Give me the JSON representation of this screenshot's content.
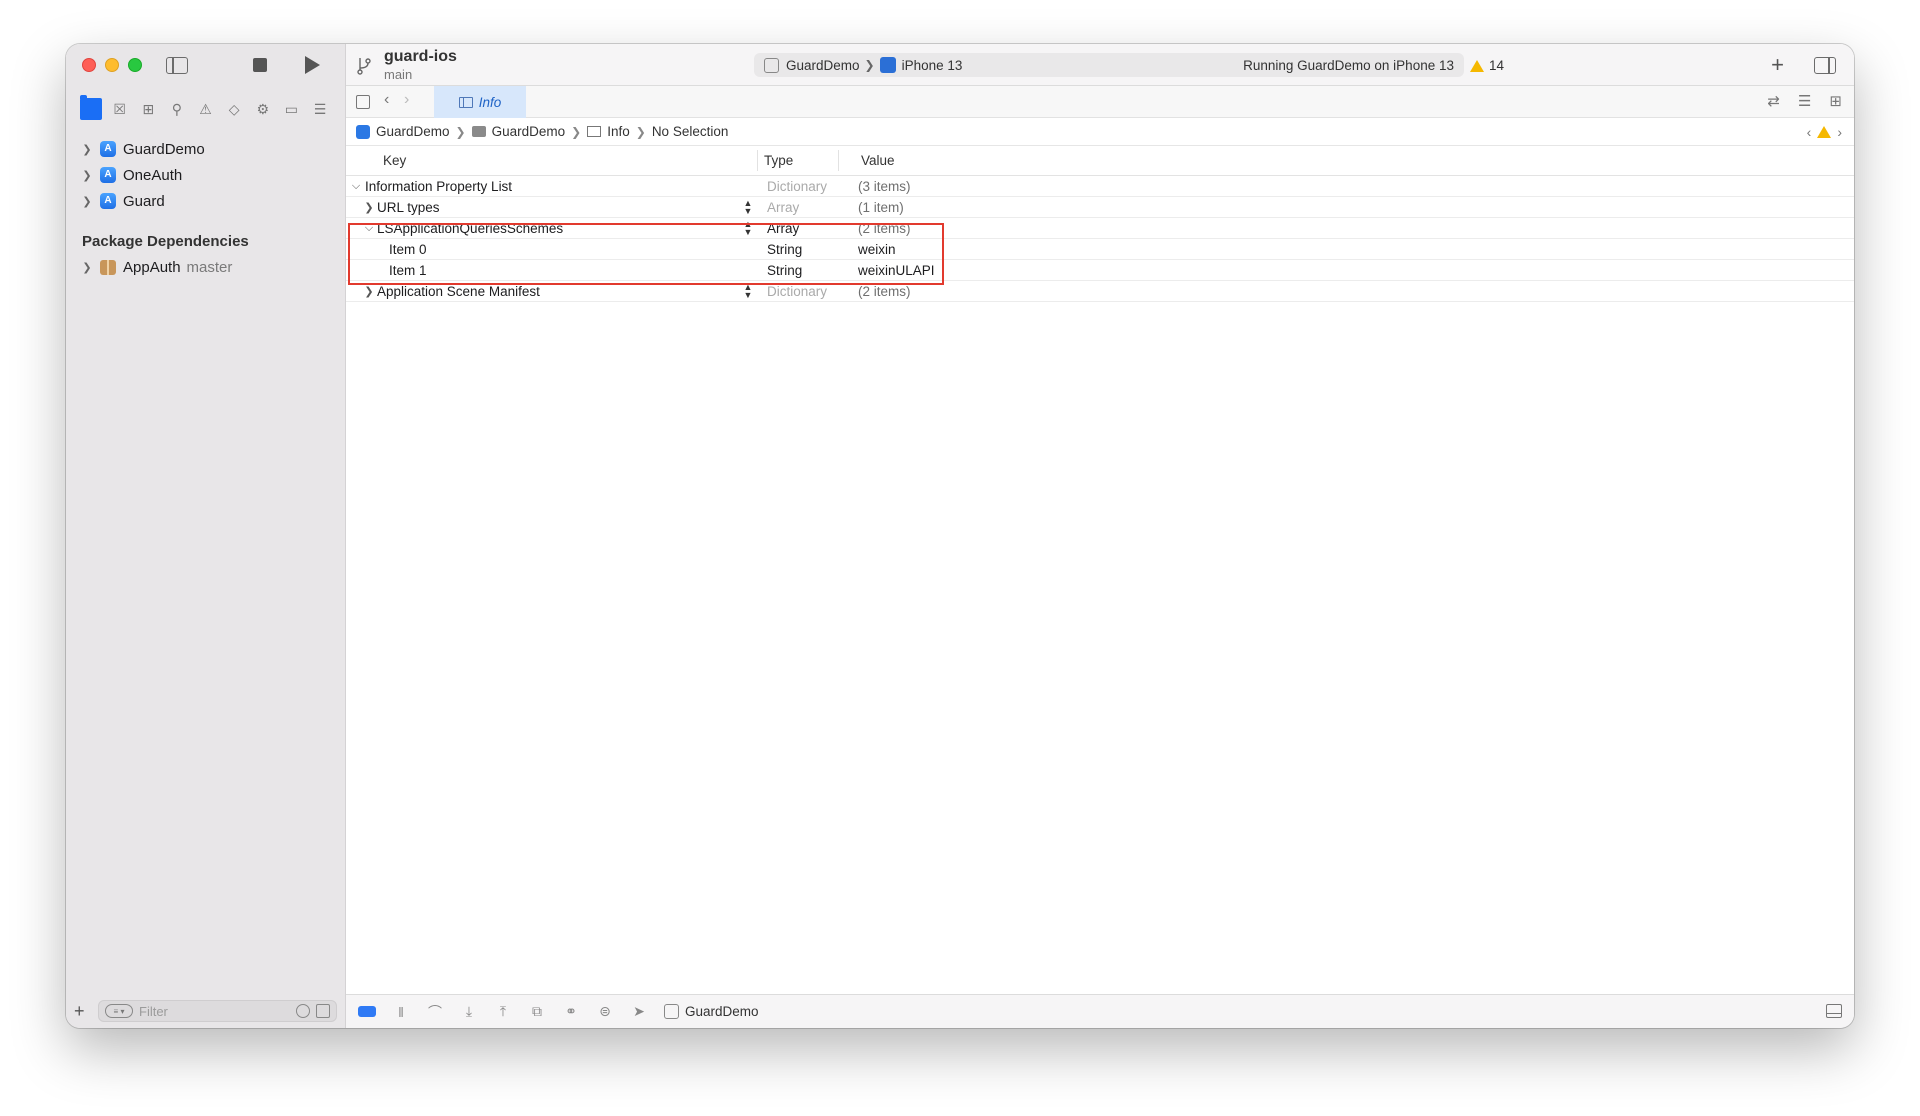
{
  "sidebar": {
    "items": [
      {
        "label": "GuardDemo"
      },
      {
        "label": "OneAuth"
      },
      {
        "label": "Guard"
      }
    ],
    "section_title": "Package Dependencies",
    "packages": [
      {
        "label": "AppAuth",
        "branch": "master"
      }
    ],
    "filter_placeholder": "Filter"
  },
  "toolbar": {
    "project_name": "guard-ios",
    "branch": "main",
    "scheme": "GuardDemo",
    "device": "iPhone 13",
    "status": "Running GuardDemo on iPhone 13",
    "warning_count": "14"
  },
  "tab": {
    "label": "Info"
  },
  "jumpbar": {
    "items": [
      "GuardDemo",
      "GuardDemo",
      "Info",
      "No Selection"
    ]
  },
  "plist": {
    "headers": {
      "key": "Key",
      "type": "Type",
      "value": "Value"
    },
    "rows": [
      {
        "key": "Information Property List",
        "type": "Dictionary",
        "value": "(3 items)"
      },
      {
        "key": "URL types",
        "type": "Array",
        "value": "(1 item)"
      },
      {
        "key": "LSApplicationQueriesSchemes",
        "type": "Array",
        "value": "(2 items)"
      },
      {
        "key": "Item 0",
        "type": "String",
        "value": "weixin"
      },
      {
        "key": "Item 1",
        "type": "String",
        "value": "weixinULAPI"
      },
      {
        "key": "Application Scene Manifest",
        "type": "Dictionary",
        "value": "(2 items)"
      }
    ]
  },
  "debugbar": {
    "target": "GuardDemo"
  },
  "colors": {
    "accent": "#1a6ef5",
    "highlight_box": "#e23a2e",
    "warning": "#f5b800"
  }
}
